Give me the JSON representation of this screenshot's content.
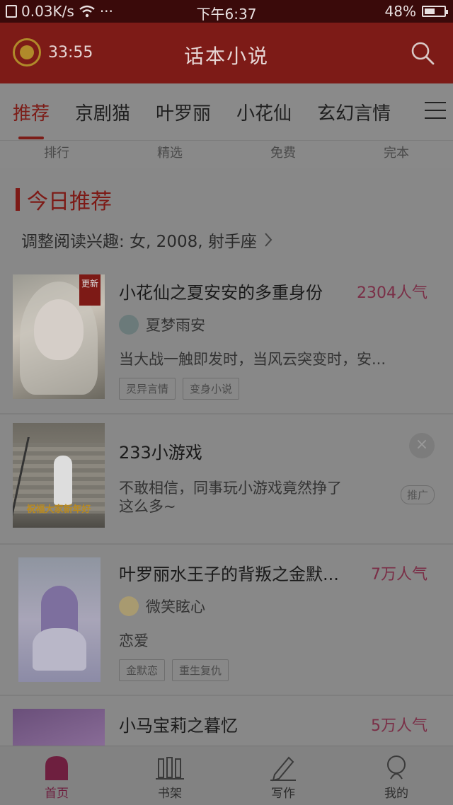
{
  "status_bar": {
    "speed": "0.03K/s",
    "signal": "wifi-icon",
    "dots": "···",
    "time": "下午6:37",
    "battery": "48%",
    "battery_level": 0.48
  },
  "header": {
    "timer": "33:55",
    "title": "话本小说"
  },
  "tabs": [
    {
      "label": "推荐",
      "active": true
    },
    {
      "label": "京剧猫"
    },
    {
      "label": "叶罗丽"
    },
    {
      "label": "小花仙"
    },
    {
      "label": "玄幻言情"
    }
  ],
  "subnav": [
    "排行",
    "精选",
    "免费",
    "完本"
  ],
  "section": {
    "title": "今日推荐",
    "interest": "调整阅读兴趣: 女, 2008, 射手座"
  },
  "books": [
    {
      "title": "小花仙之夏安安的多重身份",
      "popularity": "2304人气",
      "author": "夏梦雨安",
      "desc": "当大战一触即发时，当风云突变时，安...",
      "tags": [
        "灵异言情",
        "变身小说"
      ],
      "badge": "更新"
    },
    {
      "title": "233小游戏",
      "desc_line1": "不敢相信，同事玩小游戏竟然挣了",
      "desc_line2": "这么多~",
      "ad_label": "推广",
      "cover_caption": "祝福大家新年好"
    },
    {
      "title": "叶罗丽水王子的背叛之金默...",
      "popularity": "7万人气",
      "author": "微笑眩心",
      "desc": "恋爱",
      "tags": [
        "金默恋",
        "重生复仇"
      ]
    },
    {
      "title": "小马宝莉之暮忆",
      "popularity": "5万人气"
    }
  ],
  "bottom_nav": [
    {
      "label": "首页",
      "icon": "home-icon",
      "active": true
    },
    {
      "label": "书架",
      "icon": "bookshelf-icon"
    },
    {
      "label": "写作",
      "icon": "pen-icon"
    },
    {
      "label": "我的",
      "icon": "user-icon"
    }
  ]
}
